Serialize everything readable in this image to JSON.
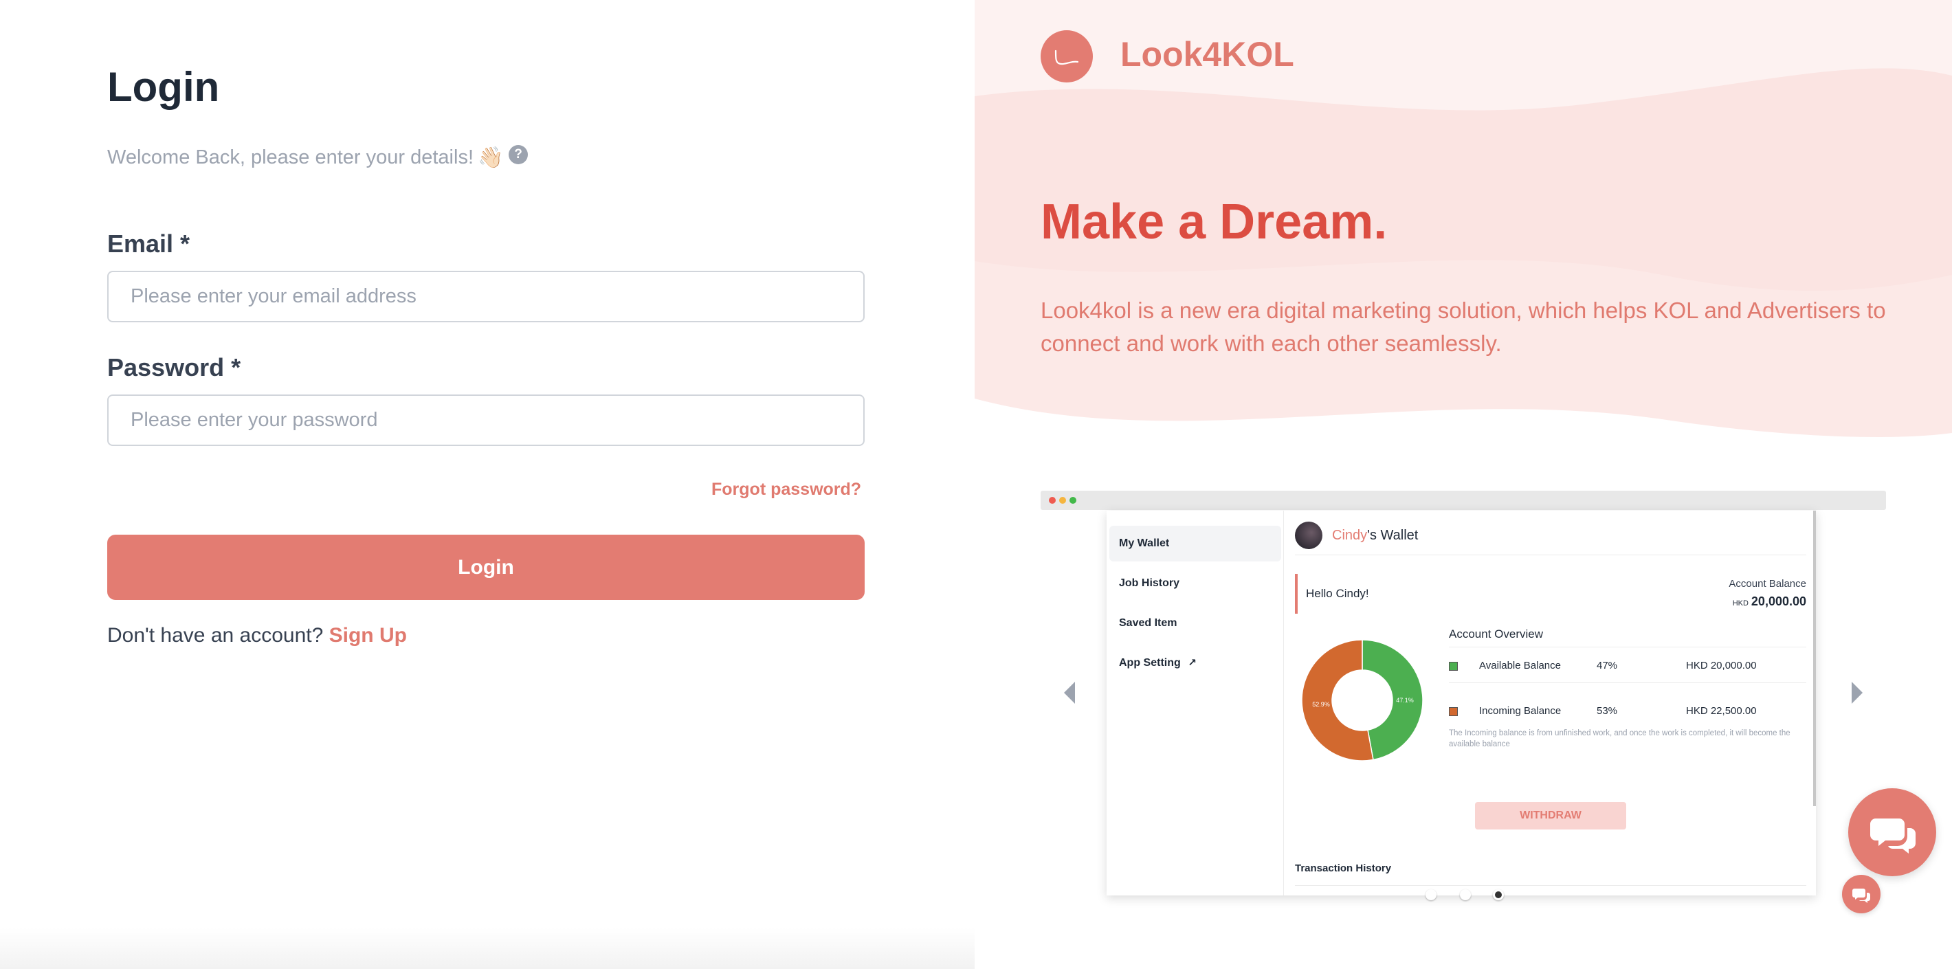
{
  "login": {
    "title": "Login",
    "welcome": "Welcome Back, please enter your details!",
    "wave_emoji": "👋🏻",
    "help_glyph": "?",
    "email_label": "Email *",
    "email_placeholder": "Please enter your email address",
    "password_label": "Password *",
    "password_placeholder": "Please enter your password",
    "forgot_label": "Forgot password?",
    "button_label": "Login",
    "signup_prompt": "Don't have an account?",
    "signup_label": "Sign Up"
  },
  "hero": {
    "brand": "Look4KOL",
    "title": "Make a Dream.",
    "description": "Look4kol is a new era digital marketing solution, which helps KOL and Advertisers to connect and work with each other seamlessly."
  },
  "wallet_preview": {
    "sidebar": [
      {
        "label": "My Wallet",
        "active": true
      },
      {
        "label": "Job History",
        "active": false
      },
      {
        "label": "Saved Item",
        "active": false
      },
      {
        "label": "App Setting",
        "active": false
      }
    ],
    "owner_name": "Cindy",
    "title_suffix": "'s Wallet",
    "greeting": "Hello Cindy!",
    "balance_label": "Account Balance",
    "balance_currency": "HKD",
    "balance_value": "20,000.00",
    "overview_title": "Account Overview",
    "rows": [
      {
        "name": "Available Balance",
        "percent": "47%",
        "amount": "HKD 20,000.00",
        "color": "#4caf50"
      },
      {
        "name": "Incoming Balance",
        "percent": "53%",
        "amount": "HKD 22,500.00",
        "color": "#d2692f"
      }
    ],
    "donut_labels": {
      "available": "47.1%",
      "incoming": "52.9%"
    },
    "donut_values": {
      "available": 47.1,
      "incoming": 52.9
    },
    "note": "The Incoming balance is from unfinished work, and once the work is completed, it will become the available balance",
    "withdraw_label": "WITHDRAW",
    "transactions_title": "Transaction History"
  },
  "colors": {
    "accent": "#e37c72",
    "hero_title": "#dc4d42",
    "available": "#4caf50",
    "incoming": "#d2692f"
  },
  "icons": {
    "help": "question-circle-icon",
    "chat": "chat-bubbles-icon",
    "external": "external-link-icon",
    "prev": "arrow-left-icon",
    "next": "arrow-right-icon"
  }
}
